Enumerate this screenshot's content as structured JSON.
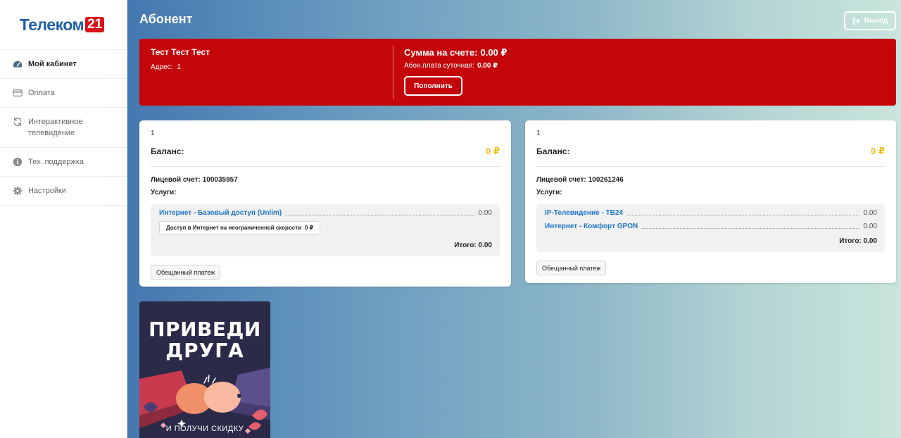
{
  "logo": {
    "text": "Телеком",
    "badge": "21"
  },
  "sidebar": {
    "items": [
      {
        "label": "Мой кабинет",
        "icon": "dashboard-icon",
        "active": true
      },
      {
        "label": "Оплата",
        "icon": "credit-card-icon",
        "active": false
      },
      {
        "label": "Интерактивное телевидение",
        "icon": "refresh-icon",
        "active": false
      },
      {
        "label": "Тех. поддержка",
        "icon": "info-icon",
        "active": false
      },
      {
        "label": "Настройки",
        "icon": "gear-icon",
        "active": false
      }
    ]
  },
  "header": {
    "title": "Абонент",
    "logout_label": "Выход"
  },
  "summary": {
    "name": "Тест Тест Тест",
    "address_label": "Адрес:",
    "address_value": "1",
    "sum_label": "Сумма на счете:",
    "sum_value": "0.00 ₽",
    "daily_label": "Абон.плата суточная:",
    "daily_value": "0.00 ₽",
    "topup_label": "Пополнить"
  },
  "accounts": [
    {
      "number": "1",
      "balance_label": "Баланс:",
      "balance_value": "0 ₽",
      "account_label": "Лицевой счет:",
      "account_value": "100035957",
      "services_label": "Услуги:",
      "services": [
        {
          "name": "Интернет - Базовый доступ (Unlim)",
          "price": "0.00"
        }
      ],
      "chip_label": "Доступ в Интернет на неограниченной скорости",
      "chip_value": "0 ₽",
      "total": "Итого: 0.00",
      "promise_label": "Обещанный платеж"
    },
    {
      "number": "1",
      "balance_label": "Баланс:",
      "balance_value": "0 ₽",
      "account_label": "Лицевой счет:",
      "account_value": "100261246",
      "services_label": "Услуги:",
      "services": [
        {
          "name": "IP-Телевидение - ТВ24",
          "price": "0.00"
        },
        {
          "name": "Интернет - Комфорт GPON",
          "price": "0.00"
        }
      ],
      "total": "Итого: 0.00",
      "promise_label": "Обещанный платеж"
    }
  ],
  "promo": {
    "line1": "ПРИВЕДИ",
    "line2": "ДРУГА",
    "subtitle": "И ПОЛУЧИ СКИДКУ"
  },
  "colors": {
    "accent_red": "#c4060b",
    "link_blue": "#1f74c9",
    "balance_yellow": "#f3bf19",
    "logo_blue": "#1c5fa8"
  }
}
